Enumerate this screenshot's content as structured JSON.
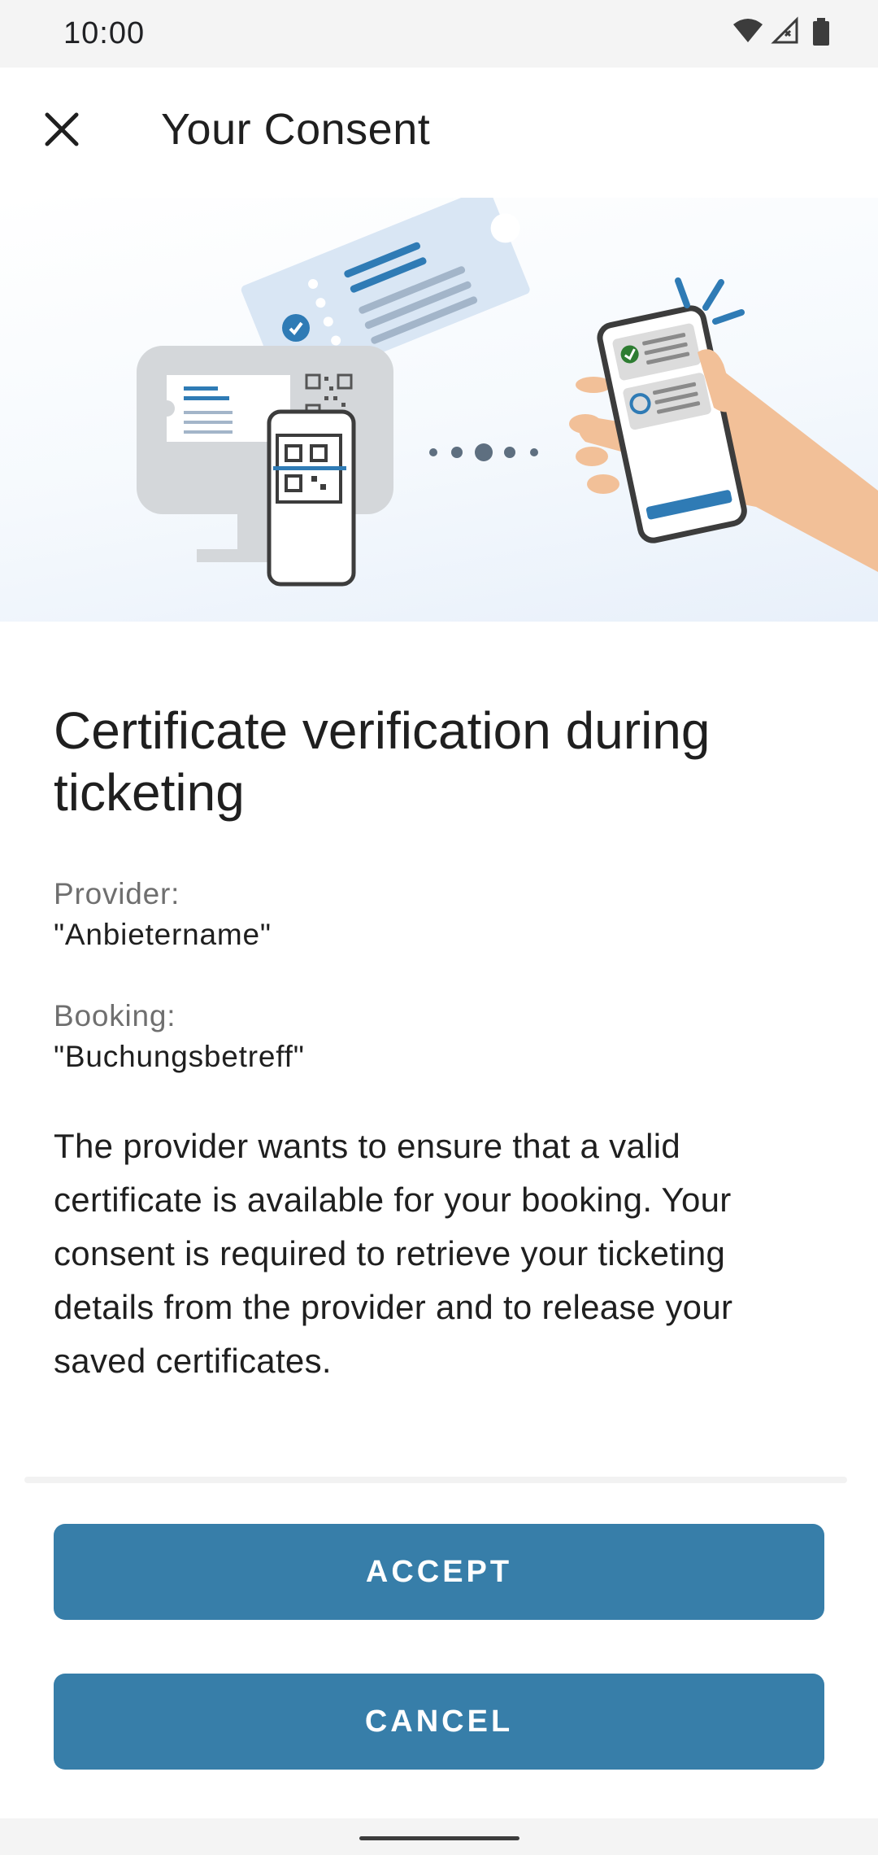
{
  "status_bar": {
    "time": "10:00",
    "icons": [
      "wifi-icon",
      "cellular-no-signal-icon",
      "battery-icon"
    ]
  },
  "app_bar": {
    "title": "Your Consent",
    "close_icon": "close-icon"
  },
  "hero": {
    "illustration": "ticket-qr-scan-to-phone-consent"
  },
  "main": {
    "heading": "Certificate verification during ticketing",
    "provider_label": "Provider:",
    "provider_value": "\"Anbietername\"",
    "booking_label": "Booking:",
    "booking_value": "\"Buchungsbetreff\"",
    "description": "The provider wants to ensure that a valid certificate is available for your booking. Your consent is required to retrieve your ticketing details from the provider and to release your saved certificates."
  },
  "actions": {
    "accept_label": "ACCEPT",
    "cancel_label": "CANCEL"
  },
  "colors": {
    "primary": "#377ea9",
    "status_bar_bg": "#f4f4f4",
    "text_primary": "#1f1f1f",
    "text_secondary": "#6f6f6f"
  }
}
